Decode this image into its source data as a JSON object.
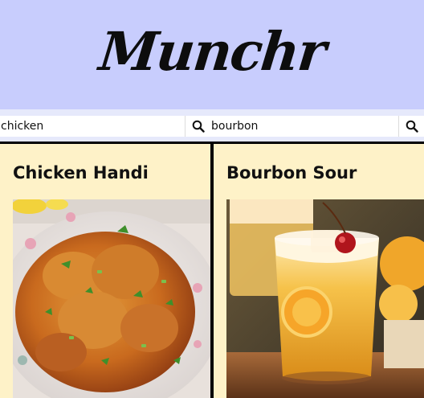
{
  "app": {
    "logo_text": "Munchr"
  },
  "search": {
    "left": {
      "value": "chicken",
      "button_icon": "search-icon"
    },
    "right": {
      "value": "bourbon",
      "button_icon": "search-icon"
    }
  },
  "cards": [
    {
      "title": "Chicken Handi",
      "image": "chicken-handi-photo"
    },
    {
      "title": "Bourbon Sour",
      "image": "bourbon-sour-photo"
    }
  ],
  "colors": {
    "header_bg": "#c8cdfd",
    "card_bg": "#fef2c8",
    "divider": "#000000"
  }
}
